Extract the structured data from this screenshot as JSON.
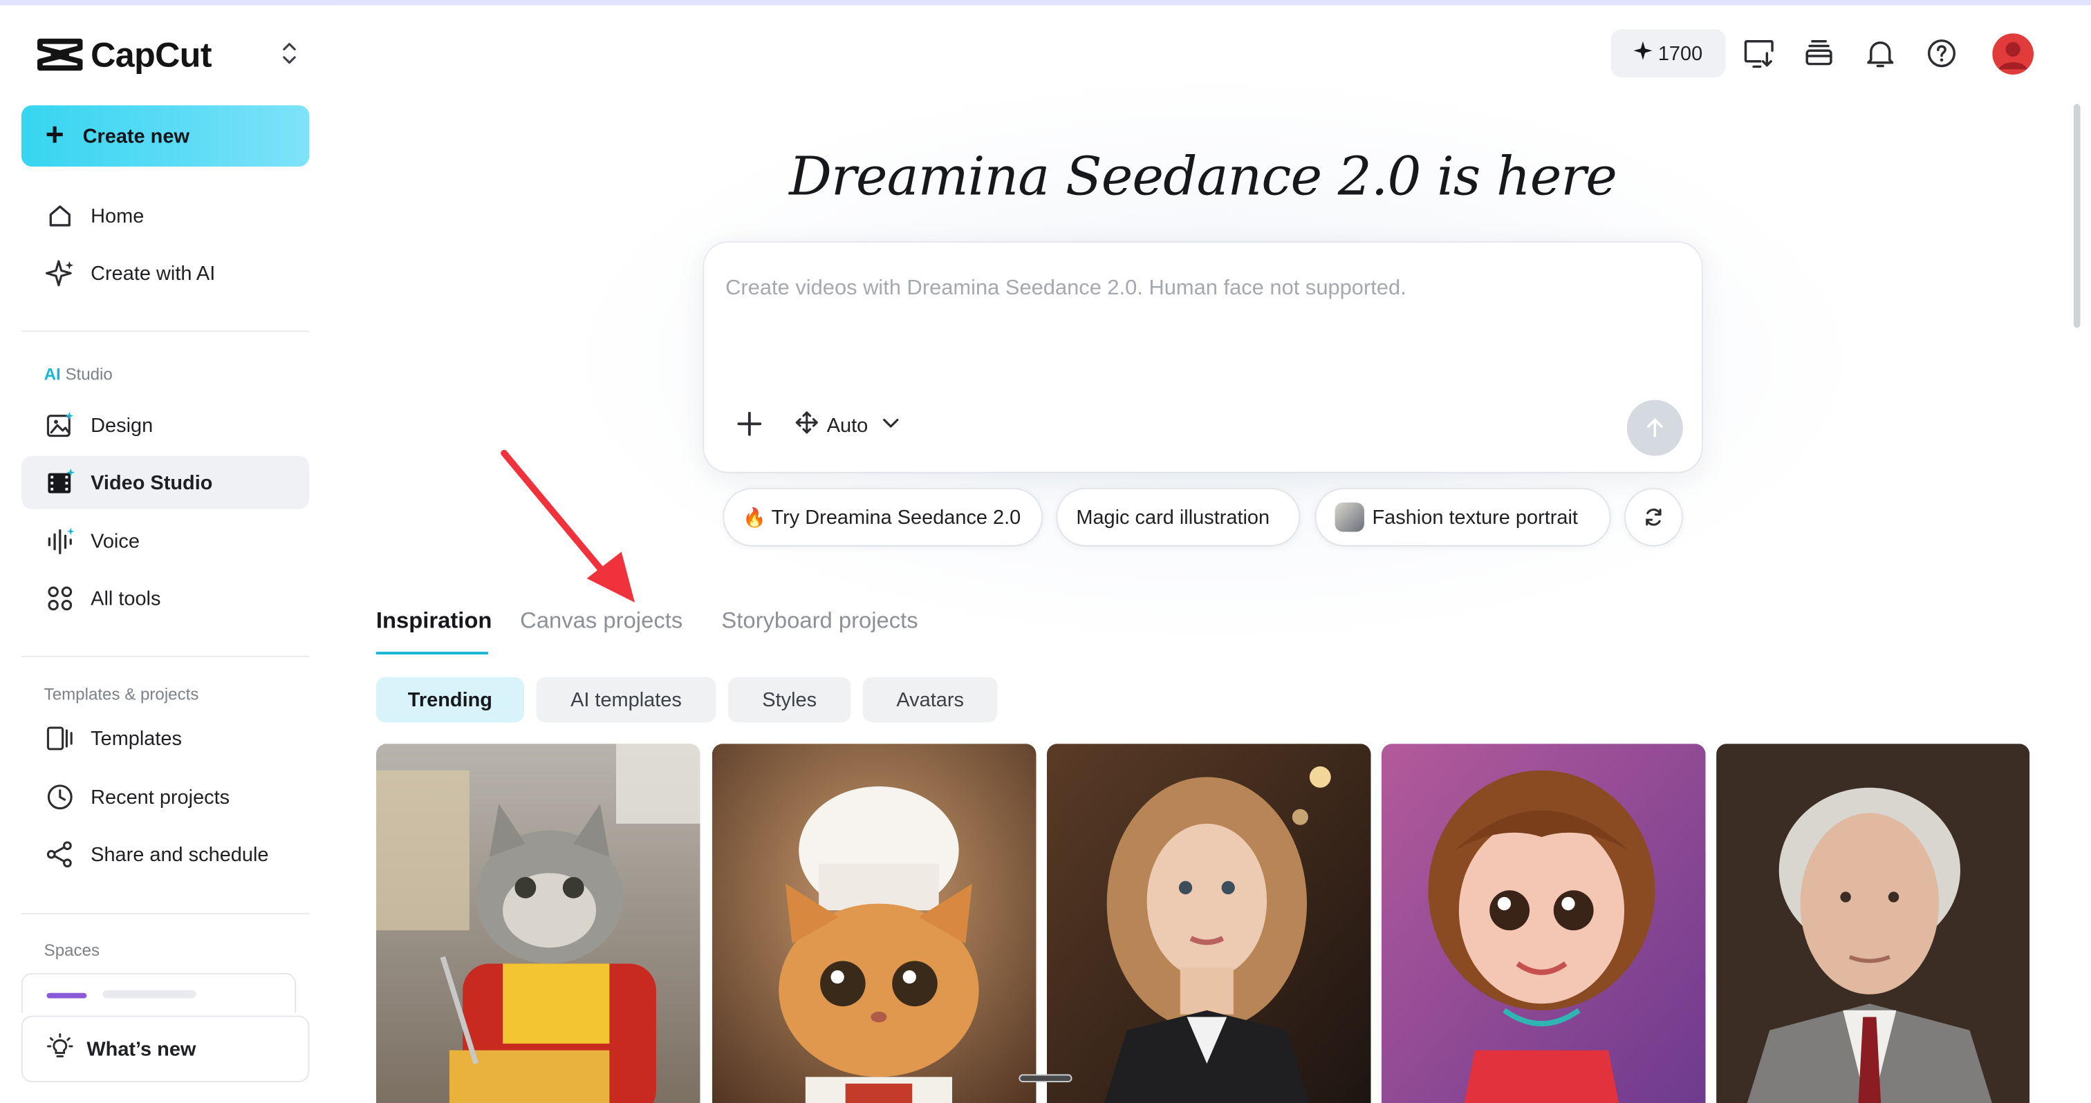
{
  "brand": {
    "name": "CapCut"
  },
  "sidebar": {
    "create_new": "Create new",
    "primary": [
      {
        "label": "Home",
        "icon": "home-icon"
      },
      {
        "label": "Create with AI",
        "icon": "sparkle-icon"
      }
    ],
    "ai_studio": {
      "title_prefix": "AI",
      "title_rest": " Studio",
      "items": [
        {
          "label": "Design",
          "icon": "image-edit-icon"
        },
        {
          "label": "Video Studio",
          "icon": "film-icon",
          "active": true
        },
        {
          "label": "Voice",
          "icon": "waveform-icon"
        },
        {
          "label": "All tools",
          "icon": "grid-icon"
        }
      ]
    },
    "templates_projects": {
      "title": "Templates & projects",
      "items": [
        {
          "label": "Templates",
          "icon": "template-icon"
        },
        {
          "label": "Recent projects",
          "icon": "clock-icon"
        },
        {
          "label": "Share and schedule",
          "icon": "share-icon"
        }
      ]
    },
    "spaces_title": "Spaces",
    "whats_new": "What’s new"
  },
  "toolbar": {
    "credits": "1700",
    "icons": [
      "download-desktop-icon",
      "stack-icon",
      "bell-icon",
      "help-icon",
      "avatar"
    ]
  },
  "hero": {
    "title": "Dreamina Seedance 2.0 is here",
    "placeholder": "Create videos with Dreamina Seedance 2.0. Human face not supported.",
    "mode": "Auto"
  },
  "suggestions": [
    {
      "label": "Try Dreamina Seedance 2.0",
      "emoji": "🔥"
    },
    {
      "label": "Magic card illustration"
    },
    {
      "label": "Fashion texture portrait"
    }
  ],
  "tabs": [
    "Inspiration",
    "Canvas projects",
    "Storyboard projects"
  ],
  "filters": [
    "Trending",
    "AI templates",
    "Styles",
    "Avatars"
  ],
  "gallery": [
    {
      "name": "gallery-card-cat-fastfood"
    },
    {
      "name": "gallery-card-chef-cat"
    },
    {
      "name": "gallery-card-woman-portrait"
    },
    {
      "name": "gallery-card-cartoon-girl"
    },
    {
      "name": "gallery-card-elderly-man"
    }
  ],
  "colors": {
    "accent": "#16b6d6",
    "create_gradient_start": "#36d5f0",
    "annotation_arrow": "#f0323c"
  }
}
